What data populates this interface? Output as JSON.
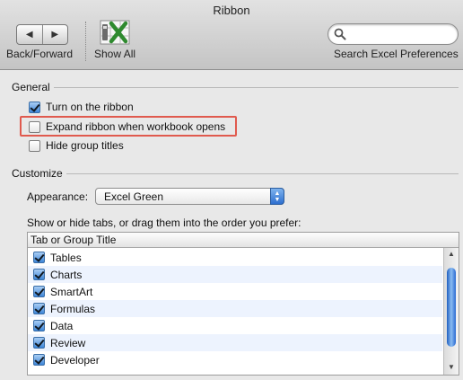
{
  "window": {
    "title": "Ribbon"
  },
  "toolbar": {
    "back_forward_label": "Back/Forward",
    "show_all_label": "Show All",
    "search_label": "Search Excel Preferences",
    "search_value": "",
    "search_placeholder": ""
  },
  "general": {
    "title": "General",
    "options": [
      {
        "label": "Turn on the ribbon",
        "checked": true
      },
      {
        "label": "Expand ribbon when workbook opens",
        "checked": false
      },
      {
        "label": "Hide group titles",
        "checked": false
      }
    ]
  },
  "customize": {
    "title": "Customize",
    "appearance_label": "Appearance:",
    "appearance_value": "Excel Green",
    "instructions": "Show or hide tabs, or drag them into the order you prefer:",
    "table": {
      "header": "Tab or Group Title",
      "rows": [
        {
          "label": "Tables",
          "checked": true
        },
        {
          "label": "Charts",
          "checked": true
        },
        {
          "label": "SmartArt",
          "checked": true
        },
        {
          "label": "Formulas",
          "checked": true
        },
        {
          "label": "Data",
          "checked": true
        },
        {
          "label": "Review",
          "checked": true
        },
        {
          "label": "Developer",
          "checked": true
        }
      ]
    }
  },
  "colors": {
    "highlight": "#e05a4e",
    "accent": "#3e86d8",
    "row_alt": "#edf3fe"
  }
}
